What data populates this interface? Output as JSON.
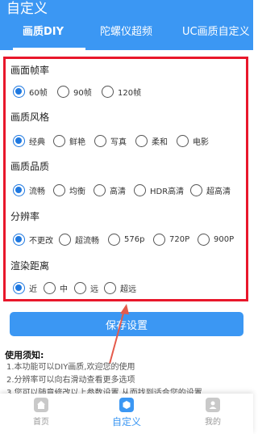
{
  "app": {
    "title": "自定义"
  },
  "tabs": [
    {
      "label": "画质DIY",
      "active": true
    },
    {
      "label": "陀螺仪超频"
    },
    {
      "label": "UC画质自定义"
    }
  ],
  "sections": [
    {
      "title": "画面帧率",
      "options": [
        {
          "label": "60帧",
          "selected": true
        },
        {
          "label": "90帧"
        },
        {
          "label": "120帧"
        }
      ]
    },
    {
      "title": "画质风格",
      "options": [
        {
          "label": "经典",
          "selected": true
        },
        {
          "label": "鲜艳"
        },
        {
          "label": "写真"
        },
        {
          "label": "柔和"
        },
        {
          "label": "电影"
        }
      ]
    },
    {
      "title": "画质品质",
      "options": [
        {
          "label": "流畅",
          "selected": true
        },
        {
          "label": "均衡"
        },
        {
          "label": "高清"
        },
        {
          "label": "HDR高清"
        },
        {
          "label": "超高清"
        }
      ]
    },
    {
      "title": "分辨率",
      "options": [
        {
          "label": "不更改",
          "selected": true
        },
        {
          "label": "超流畅"
        },
        {
          "label": "576p"
        },
        {
          "label": "720P"
        },
        {
          "label": "900P"
        }
      ]
    },
    {
      "title": "渲染距离",
      "options": [
        {
          "label": "近",
          "selected": true
        },
        {
          "label": "中"
        },
        {
          "label": "远"
        },
        {
          "label": "超远"
        }
      ]
    }
  ],
  "save_button": {
    "label": "保存设置"
  },
  "notes": {
    "title": "使用须知:",
    "items": [
      "1.本功能可以DIY画质,欢迎您的使用",
      "2.分辨率可以向右滑动查看更多选项",
      "3.您可以随意修改以上参数设置,从而找到适合您的设置"
    ]
  },
  "bottom_nav": [
    {
      "label": "首页",
      "icon": "home-icon"
    },
    {
      "label": "自定义",
      "icon": "customize-icon",
      "active": true
    },
    {
      "label": "我的",
      "icon": "profile-icon"
    }
  ],
  "colors": {
    "primary": "#3b97f3",
    "radio_selected": "#1e78e0",
    "highlight_border": "#e8172b",
    "annotation_arrow": "#e55a4b"
  }
}
